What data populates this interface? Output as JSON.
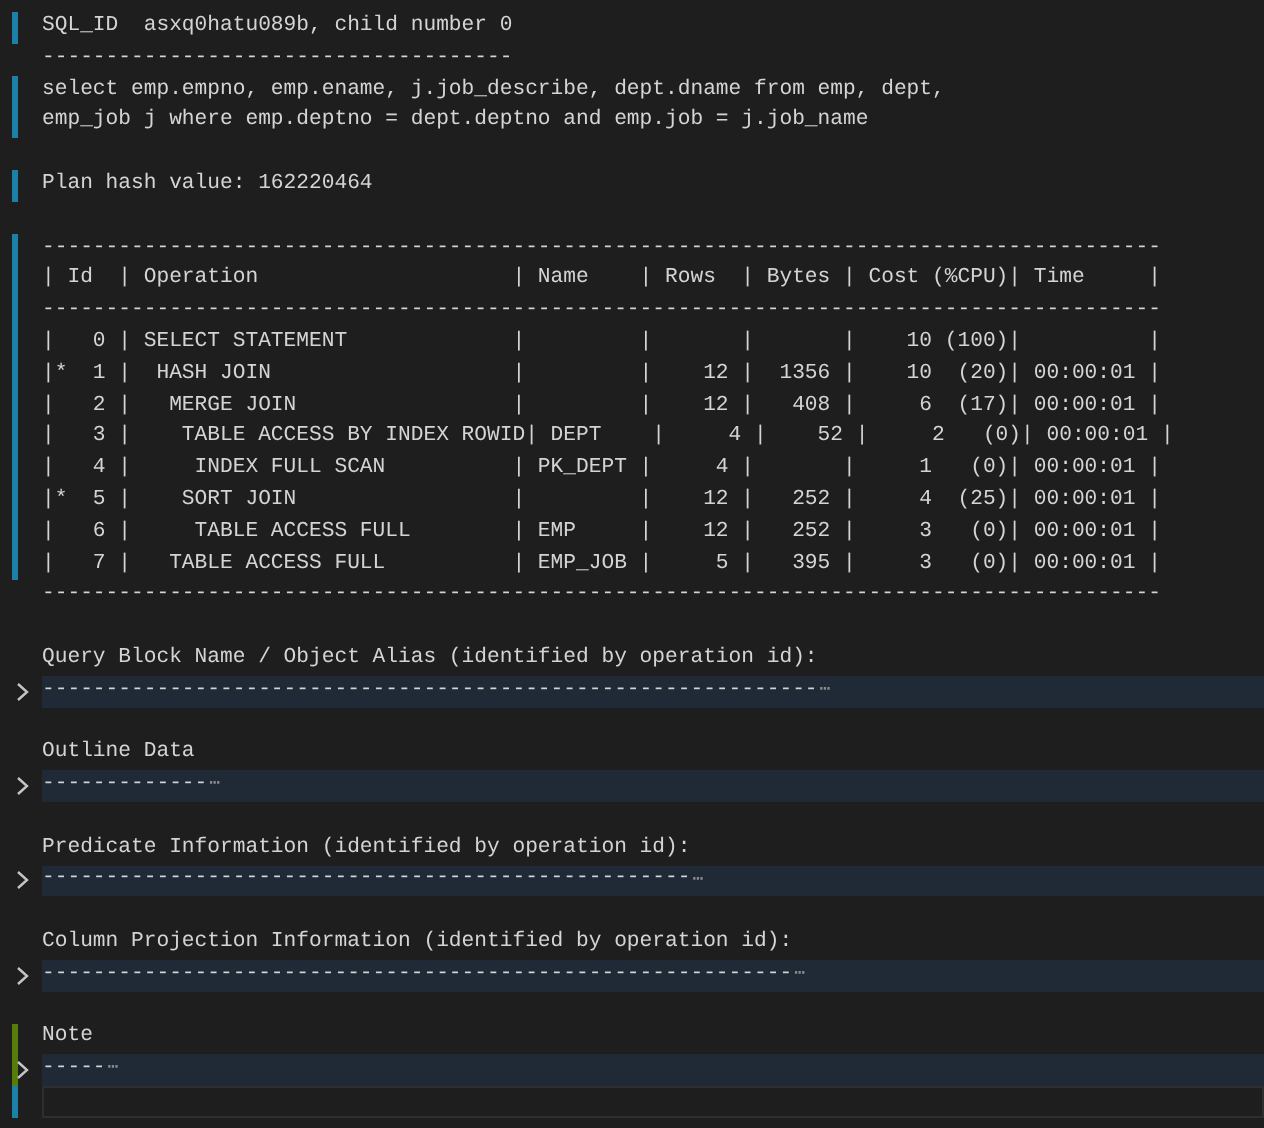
{
  "editor": {
    "lines": [
      {
        "kind": "text",
        "modified": true,
        "added": false,
        "text": "SQL_ID  asxq0hatu089b, child number 0"
      },
      {
        "kind": "text",
        "modified": false,
        "added": false,
        "text": "-------------------------------------"
      },
      {
        "kind": "text",
        "modified": true,
        "added": false,
        "text": "select emp.empno, emp.ename, j.job_describe, dept.dname from emp, dept,"
      },
      {
        "kind": "text",
        "modified": true,
        "added": false,
        "text": "emp_job j where emp.deptno = dept.deptno and emp.job = j.job_name"
      },
      {
        "kind": "blank",
        "modified": false,
        "added": false
      },
      {
        "kind": "text",
        "modified": true,
        "added": false,
        "text": "Plan hash value: 162220464"
      },
      {
        "kind": "blank",
        "modified": false,
        "added": false
      },
      {
        "kind": "text",
        "modified": true,
        "added": false,
        "text": "----------------------------------------------------------------------------------------"
      },
      {
        "kind": "text",
        "modified": true,
        "added": false,
        "text": "| Id  | Operation                    | Name    | Rows  | Bytes | Cost (%CPU)| Time     |"
      },
      {
        "kind": "text",
        "modified": true,
        "added": false,
        "text": "----------------------------------------------------------------------------------------"
      },
      {
        "kind": "text",
        "modified": true,
        "added": false,
        "text": "|   0 | SELECT STATEMENT             |         |       |       |    10 (100)|          |"
      },
      {
        "kind": "text",
        "modified": true,
        "added": false,
        "text": "|*  1 |  HASH JOIN                   |         |    12 |  1356 |    10  (20)| 00:00:01 |"
      },
      {
        "kind": "text",
        "modified": true,
        "added": false,
        "text": "|   2 |   MERGE JOIN                 |         |    12 |   408 |     6  (17)| 00:00:01 |"
      },
      {
        "kind": "text",
        "modified": true,
        "added": false,
        "text": "|   3 |    TABLE ACCESS BY INDEX ROWID| DEPT    |     4 |    52 |     2   (0)| 00:00:01 |"
      },
      {
        "kind": "text",
        "modified": true,
        "added": false,
        "text": "|   4 |     INDEX FULL SCAN          | PK_DEPT |     4 |       |     1   (0)| 00:00:01 |"
      },
      {
        "kind": "text",
        "modified": true,
        "added": false,
        "text": "|*  5 |    SORT JOIN                 |         |    12 |   252 |     4  (25)| 00:00:01 |"
      },
      {
        "kind": "text",
        "modified": true,
        "added": false,
        "text": "|   6 |     TABLE ACCESS FULL        | EMP     |    12 |   252 |     3   (0)| 00:00:01 |"
      },
      {
        "kind": "text",
        "modified": true,
        "added": false,
        "text": "|   7 |   TABLE ACCESS FULL          | EMP_JOB |     5 |   395 |     3   (0)| 00:00:01 |"
      },
      {
        "kind": "text",
        "modified": false,
        "added": false,
        "text": "----------------------------------------------------------------------------------------"
      },
      {
        "kind": "blank",
        "modified": false,
        "added": false
      },
      {
        "kind": "text",
        "modified": false,
        "added": false,
        "text": "Query Block Name / Object Alias (identified by operation id):"
      },
      {
        "kind": "folded",
        "modified": false,
        "added": false,
        "text": "-------------------------------------------------------------",
        "ellipsis": "⋯"
      },
      {
        "kind": "blank",
        "modified": false,
        "added": false
      },
      {
        "kind": "text",
        "modified": false,
        "added": false,
        "text": "Outline Data"
      },
      {
        "kind": "folded",
        "modified": false,
        "added": false,
        "text": "-------------",
        "ellipsis": "⋯"
      },
      {
        "kind": "blank",
        "modified": false,
        "added": false
      },
      {
        "kind": "text",
        "modified": false,
        "added": false,
        "text": "Predicate Information (identified by operation id):"
      },
      {
        "kind": "folded",
        "modified": false,
        "added": false,
        "text": "---------------------------------------------------",
        "ellipsis": "⋯"
      },
      {
        "kind": "blank",
        "modified": false,
        "added": false
      },
      {
        "kind": "text",
        "modified": false,
        "added": false,
        "text": "Column Projection Information (identified by operation id):"
      },
      {
        "kind": "folded",
        "modified": false,
        "added": false,
        "text": "-----------------------------------------------------------",
        "ellipsis": "⋯"
      },
      {
        "kind": "blank",
        "modified": false,
        "added": false
      },
      {
        "kind": "text",
        "modified": false,
        "added": true,
        "text": "Note"
      },
      {
        "kind": "folded",
        "modified": false,
        "added": true,
        "text": "-----",
        "ellipsis": "⋯"
      },
      {
        "kind": "current",
        "modified": true,
        "added": false
      }
    ]
  }
}
